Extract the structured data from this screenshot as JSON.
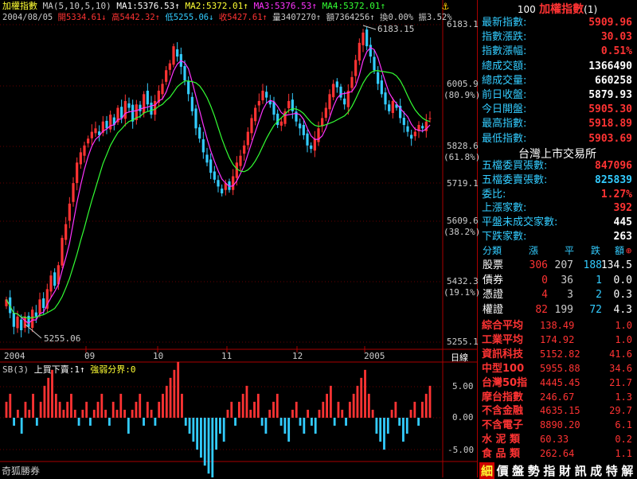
{
  "header": {
    "title": "加權指數",
    "ma_spec": "MA(5,10,5,10)",
    "ma1": "MA1:5376.53↑",
    "ma2": "MA2:5372.01↑",
    "ma3": "MA3:5376.53↑",
    "ma4": "MA4:5372.01↑",
    "date": "2004/08/05",
    "open": "開5334.61↓",
    "high": "高5442.32↑",
    "low": "低5255.06↓",
    "close": "收5427.61↑",
    "volume": "量3407270↑",
    "amount": "額7364256↑",
    "turnover": "換0.00%",
    "amplitude": "振3.52%"
  },
  "price_axis": {
    "ticks": [
      "6183.1",
      "6005.9",
      "(80.9%)",
      "5828.6",
      "(61.8%)",
      "5719.1",
      "5609.6",
      "(38.2%)",
      "5432.3",
      "(19.1%)",
      "5255.1"
    ]
  },
  "annotations": {
    "high_label": "6183.15",
    "low_label": "5255.06"
  },
  "time_axis": {
    "labels": [
      "2004",
      "09",
      "10",
      "11",
      "12",
      "2005"
    ],
    "mode": "日線"
  },
  "indicator": {
    "header_name": "SB(3)",
    "header_desc": "上買下賣:1↑",
    "header_sep": "強弱分界:0",
    "ticks": [
      "5.00",
      "0.00",
      "-5.00"
    ]
  },
  "footer": {
    "broker": "奇狐勝券"
  },
  "panel": {
    "title_code": "100",
    "title_name": "加權指數",
    "title_suffix": "(1)",
    "quote": [
      {
        "label": "最新指數:",
        "value": "5909.96",
        "color": "red"
      },
      {
        "label": "指數漲跌:",
        "value": "30.03",
        "color": "red"
      },
      {
        "label": "指數漲幅:",
        "value": "0.51%",
        "color": "red"
      },
      {
        "label": "總成交額:",
        "value": "1366490",
        "color": "white"
      },
      {
        "label": "總成交量:",
        "value": "660258",
        "color": "white"
      },
      {
        "label": "前日收盤:",
        "value": "5879.93",
        "color": "white"
      },
      {
        "label": "今日開盤:",
        "value": "5905.30",
        "color": "red"
      },
      {
        "label": "最高指數:",
        "value": "5918.89",
        "color": "red"
      },
      {
        "label": "最低指數:",
        "value": "5903.69",
        "color": "red"
      }
    ],
    "market_title": "台灣上市交易所",
    "market": [
      {
        "label": "五檔委買張數:",
        "value": "847096",
        "color": "red"
      },
      {
        "label": "五檔委賣張數:",
        "value": "825839",
        "color": "cyan"
      },
      {
        "label": "委比:",
        "value": "1.27%",
        "color": "red"
      },
      {
        "label": "上漲家數:",
        "value": "392",
        "color": "red"
      },
      {
        "label": "平盤未成交家數:",
        "value": "445",
        "color": "white"
      },
      {
        "label": "下跌家數:",
        "value": "263",
        "color": "white"
      }
    ],
    "grid_header": {
      "c0": "分類",
      "c1": "漲",
      "c2": "平",
      "c3": "跌",
      "c4": "額"
    },
    "grid": [
      {
        "cat": "股票",
        "up": "306",
        "flat": "207",
        "down": "188",
        "amt": "134.5"
      },
      {
        "cat": "債券",
        "up": "0",
        "flat": "36",
        "down": "1",
        "amt": "0.0"
      },
      {
        "cat": "憑證",
        "up": "4",
        "flat": "3",
        "down": "2",
        "amt": "0.3"
      },
      {
        "cat": "權證",
        "up": "82",
        "flat": "199",
        "down": "72",
        "amt": "4.3"
      }
    ],
    "indices": [
      {
        "name": "綜合平均",
        "value": "138.49",
        "amt": "1.0"
      },
      {
        "name": "工業平均",
        "value": "174.92",
        "amt": "1.0"
      },
      {
        "name": "資訊科技",
        "value": "5152.82",
        "amt": "41.6"
      },
      {
        "name": "中型100",
        "value": "5955.88",
        "amt": "34.6"
      },
      {
        "name": "台灣50指",
        "value": "4445.45",
        "amt": "21.7"
      },
      {
        "name": "摩台指數",
        "value": "246.67",
        "amt": "1.3"
      },
      {
        "name": "不含金融",
        "value": "4635.15",
        "amt": "29.7"
      },
      {
        "name": "不含電子",
        "value": "8890.20",
        "amt": "6.1"
      },
      {
        "name": "水 泥 類",
        "value": "60.33",
        "amt": "0.2"
      },
      {
        "name": "食 品 類",
        "value": "262.64",
        "amt": "1.1"
      }
    ],
    "bottom_tabs": [
      "細",
      "價",
      "盤",
      "勢",
      "指",
      "財",
      "訊",
      "成",
      "特",
      "解"
    ]
  },
  "chart_data": {
    "type": "candlestick",
    "title": "加權指數",
    "ylim": [
      5255.1,
      6183.1
    ],
    "up_color": "#ff3333",
    "down_color": "#33ccff",
    "ma_colors": {
      "ma5": "#ff33ff",
      "ma10": "#33ff33"
    },
    "x_labels": [
      "2004",
      "09",
      "10",
      "11",
      "12",
      "2005"
    ],
    "high_value": 6183.15,
    "low_value": 5255.06,
    "closes": [
      5380,
      5340,
      5300,
      5330,
      5290,
      5330,
      5300,
      5350,
      5330,
      5380,
      5355,
      5410,
      5450,
      5420,
      5480,
      5560,
      5600,
      5660,
      5720,
      5780,
      5810,
      5830,
      5850,
      5870,
      5880,
      5860,
      5900,
      5880,
      5920,
      5890,
      5940,
      5910,
      5960,
      5940,
      5900,
      5950,
      5930,
      5980,
      5950,
      5920,
      5960,
      5990,
      6010,
      6050,
      6070,
      6120,
      6090,
      6060,
      6020,
      5980,
      5930,
      5880,
      5850,
      5810,
      5780,
      5750,
      5730,
      5710,
      5690,
      5720,
      5700,
      5740,
      5780,
      5800,
      5830,
      5870,
      5910,
      5940,
      5960,
      5990,
      5970,
      5950,
      5920,
      5890,
      5900,
      5930,
      5960,
      5930,
      5900,
      5880,
      5860,
      5830,
      5820,
      5850,
      5880,
      5910,
      5940,
      5980,
      6010,
      6000,
      5970,
      5950,
      5990,
      6030,
      6080,
      6130,
      6160,
      6120,
      6090,
      6050,
      6010,
      5980,
      5950,
      5930,
      5960,
      5940,
      5910,
      5890,
      5870,
      5850,
      5870,
      5890,
      5880,
      5900,
      5910
    ],
    "indicator_ylim": [
      -7,
      7
    ],
    "indicator_values": [
      2,
      3,
      -1,
      1,
      -2,
      2,
      1,
      3,
      -1,
      2,
      4,
      5,
      6,
      3,
      2,
      1,
      2,
      3,
      1,
      -1,
      1,
      2,
      -1,
      1,
      2,
      3,
      1,
      -1,
      2,
      1,
      3,
      1,
      -2,
      1,
      2,
      3,
      -1,
      2,
      1,
      -1,
      2,
      3,
      4,
      5,
      6,
      7,
      3,
      -1,
      -2,
      -3,
      -4,
      -5,
      -6,
      -7,
      -8,
      -4,
      -2,
      -3,
      1,
      2,
      -1,
      2,
      3,
      4,
      1,
      2,
      3,
      -1,
      -2,
      1,
      2,
      3,
      -1,
      -2,
      -3,
      1,
      2,
      -1,
      -2,
      1,
      -1,
      -2,
      1,
      2,
      3,
      4,
      -1,
      2,
      1,
      -1,
      2,
      3,
      4,
      5,
      6,
      3,
      1,
      -2,
      -3,
      -4,
      -2,
      1,
      2,
      -1,
      -3,
      -2,
      1,
      2,
      -1,
      2,
      3,
      4
    ]
  }
}
